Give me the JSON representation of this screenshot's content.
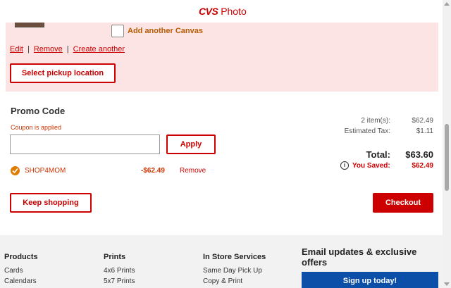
{
  "header": {
    "brand": "CVS",
    "product": "Photo"
  },
  "item": {
    "add_canvas_label": "Add another Canvas",
    "links": {
      "edit": "Edit",
      "remove": "Remove",
      "create": "Create another",
      "separator": "|"
    },
    "pickup_button": "Select pickup location"
  },
  "promo": {
    "title": "Promo Code",
    "status": "Coupon is applied",
    "input_value": "",
    "apply_button": "Apply",
    "applied_code": "SHOP4MOM",
    "applied_discount": "-$62.49",
    "remove_label": "Remove"
  },
  "summary": {
    "items_label": "2 item(s):",
    "items_value": "$62.49",
    "tax_label": "Estimated Tax:",
    "tax_value": "$1.11",
    "total_label": "Total:",
    "total_value": "$63.60",
    "info_glyph": "i",
    "saved_label": "You Saved:",
    "saved_value": "$62.49"
  },
  "actions": {
    "keep_shopping": "Keep shopping",
    "checkout": "Checkout"
  },
  "footer": {
    "columns": [
      {
        "title": "Products",
        "items": [
          "Cards",
          "Calendars"
        ]
      },
      {
        "title": "Prints",
        "items": [
          "4x6 Prints",
          "5x7 Prints"
        ]
      },
      {
        "title": "In Store Services",
        "items": [
          "Same Day Pick Up",
          "Copy & Print"
        ]
      }
    ],
    "email_title": "Email updates & exclusive offers",
    "signup_button": "Sign up today!"
  },
  "colors": {
    "brand_red": "#cc0000",
    "pink_bg": "#fce4e4",
    "signup_blue": "#0c4fa8",
    "accent_orange": "#e07b00"
  }
}
